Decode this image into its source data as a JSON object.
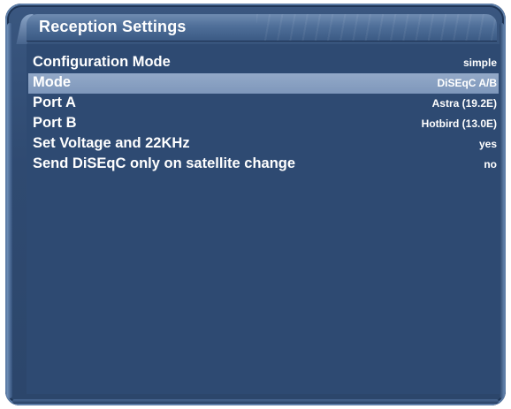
{
  "window": {
    "title": "Reception Settings"
  },
  "settings": [
    {
      "label": "Configuration Mode",
      "value": "simple",
      "selected": false
    },
    {
      "label": "Mode",
      "value": "DiSEqC A/B",
      "selected": true
    },
    {
      "label": "Port A",
      "value": "Astra (19.2E)",
      "selected": false
    },
    {
      "label": "Port B",
      "value": "Hotbird (13.0E)",
      "selected": false
    },
    {
      "label": "Set Voltage and 22KHz",
      "value": "yes",
      "selected": false
    },
    {
      "label": "Send DiSEqC only on satellite change",
      "value": "no",
      "selected": false
    }
  ],
  "colors": {
    "background": "#2e4a72",
    "title_bar": "#5a779f",
    "selected_row": "#879fc1",
    "text": "#ffffff"
  }
}
